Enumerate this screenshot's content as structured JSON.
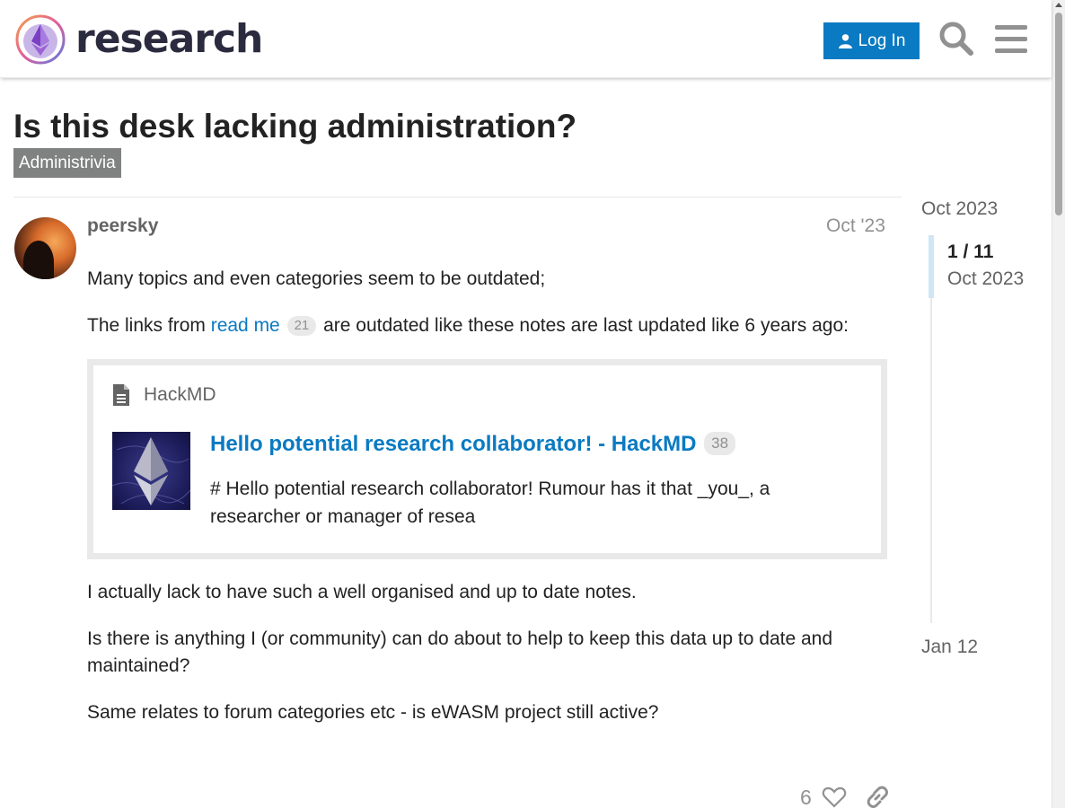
{
  "header": {
    "logo_text": "research",
    "login_label": "Log In",
    "search_icon": "search-icon",
    "menu_icon": "hamburger-menu-icon"
  },
  "topic": {
    "title": "Is this desk lacking administration?",
    "category": "Administrivia",
    "category_color": "#808281"
  },
  "post": {
    "username": "peersky",
    "date": "Oct '23",
    "p1": "Many topics and even categories seem to be outdated;",
    "p2_before": "The links from ",
    "p2_link": "read me",
    "p2_link_clicks": "21",
    "p2_after": " are outdated like these notes are last updated like 6 years ago:",
    "onebox": {
      "source": "HackMD",
      "title": "Hello potential research collaborator! - HackMD",
      "title_clicks": "38",
      "description": "# Hello potential research collaborator! Rumour has it that _you_, a researcher or manager of resea"
    },
    "p3": "I actually lack to have such a well organised and up to date notes.",
    "p4": "Is there is anything I (or community) can do about to help to keep this data up to date and maintained?",
    "p5": "Same relates to forum categories etc - is eWASM project still active?",
    "like_count": "6"
  },
  "timeline": {
    "start_date": "Oct 2023",
    "position": "1 / 11",
    "position_date": "Oct 2023",
    "end_date": "Jan 12"
  },
  "colors": {
    "accent": "#0a7ac2",
    "muted": "#919191"
  }
}
